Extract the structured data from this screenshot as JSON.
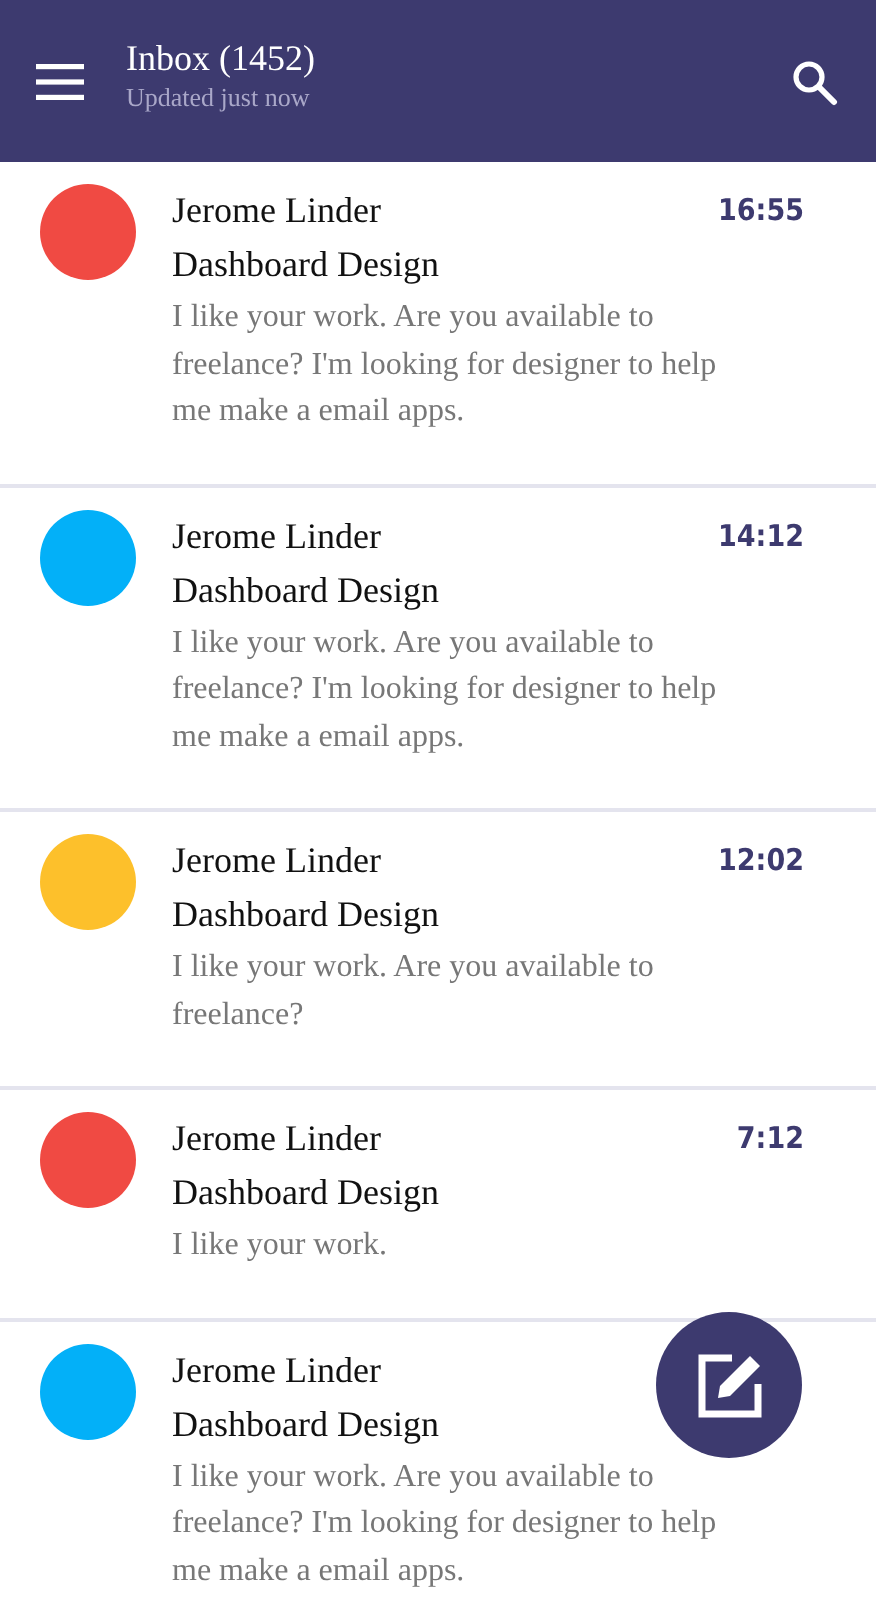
{
  "header": {
    "title": "Inbox (1452)",
    "subtitle": "Updated just now"
  },
  "messages": [
    {
      "sender": "Jerome Linder",
      "subject": "Dashboard Design",
      "snippet": "I like your work. Are you available to freelance? I'm looking for designer to help me make a email apps.",
      "time": "16:55",
      "color": "#f04a43"
    },
    {
      "sender": "Jerome Linder",
      "subject": "Dashboard Design",
      "snippet": "I like your work. Are you available to freelance? I'm looking for designer to help me make a email apps.",
      "time": "14:12",
      "color": "#03b0f8"
    },
    {
      "sender": "Jerome Linder",
      "subject": "Dashboard Design",
      "snippet": "I like your work. Are you available to freelance?",
      "time": "12:02",
      "color": "#fdc02b"
    },
    {
      "sender": "Jerome Linder",
      "subject": "Dashboard Design",
      "snippet": "I like your work.",
      "time": "7:12",
      "color": "#f04a43"
    },
    {
      "sender": "Jerome Linder",
      "subject": "Dashboard Design",
      "snippet": "I like your work. Are you available to freelance? I'm looking for designer to help me make a email apps.",
      "color": "#03b0f8"
    }
  ]
}
